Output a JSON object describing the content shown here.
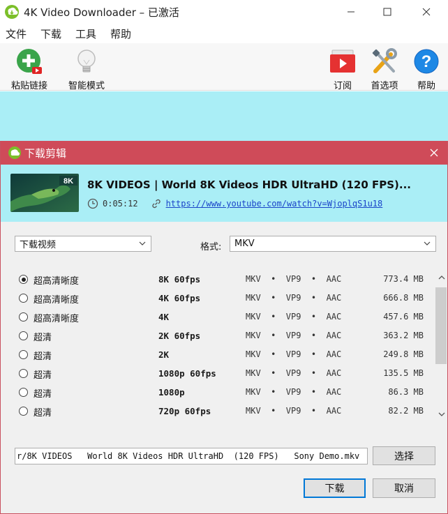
{
  "window": {
    "title": "4K Video Downloader – 已激活"
  },
  "menu": {
    "items": [
      "文件",
      "下载",
      "工具",
      "帮助"
    ]
  },
  "toolbar": {
    "paste_label": "粘贴链接",
    "smart_label": "智能模式",
    "subscribe_label": "订阅",
    "prefs_label": "首选项",
    "help_label": "帮助"
  },
  "dialog": {
    "title": "下载剪辑",
    "video_title": "8K VIDEOS | World 8K Videos HDR UltraHD  (120 FPS)...",
    "duration": "0:05:12",
    "url": "https://www.youtube.com/watch?v=WjoplqS1u18",
    "thumb_badge": "8K",
    "action_select": "下载视频",
    "format_label": "格式:",
    "format_value": "MKV",
    "rows": [
      {
        "quality": "超高清晰度",
        "res": "8K 60fps",
        "codec": "MKV  •  VP9  •  AAC",
        "size": "773.4 MB",
        "checked": true
      },
      {
        "quality": "超高清晰度",
        "res": "4K 60fps",
        "codec": "MKV  •  VP9  •  AAC",
        "size": "666.8 MB",
        "checked": false
      },
      {
        "quality": "超高清晰度",
        "res": "4K",
        "codec": "MKV  •  VP9  •  AAC",
        "size": "457.6 MB",
        "checked": false
      },
      {
        "quality": "超清",
        "res": "2K 60fps",
        "codec": "MKV  •  VP9  •  AAC",
        "size": "363.2 MB",
        "checked": false
      },
      {
        "quality": "超清",
        "res": "2K",
        "codec": "MKV  •  VP9  •  AAC",
        "size": "249.8 MB",
        "checked": false
      },
      {
        "quality": "超清",
        "res": "1080p 60fps",
        "codec": "MKV  •  VP9  •  AAC",
        "size": "135.5 MB",
        "checked": false
      },
      {
        "quality": "超清",
        "res": "1080p",
        "codec": "MKV  •  VP9  •  AAC",
        "size": "86.3 MB",
        "checked": false
      },
      {
        "quality": "超清",
        "res": "720p 60fps",
        "codec": "MKV  •  VP9  •  AAC",
        "size": "82.2 MB",
        "checked": false
      }
    ],
    "path_value": "r/8K VIDEOS   World 8K Videos HDR UltraHD  (120 FPS)   Sony Demo.mkv",
    "choose_label": "选择",
    "download_label": "下载",
    "cancel_label": "取消"
  },
  "colors": {
    "accent_red": "#cf4b59",
    "cyan": "#aaeef6",
    "link": "#1a44c9"
  }
}
